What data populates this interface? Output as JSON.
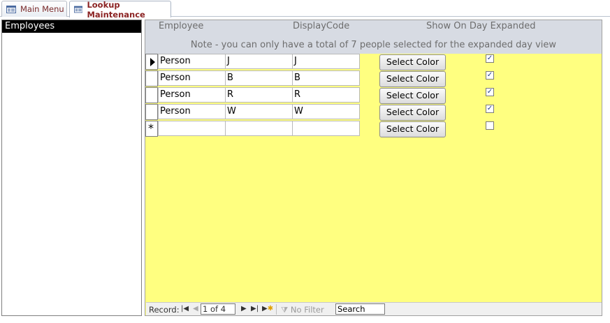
{
  "tabs": [
    {
      "label": "Main Menu",
      "active": false
    },
    {
      "label": "Lookup Maintenance",
      "active": true
    }
  ],
  "nav_list": {
    "items": [
      "Employees"
    ]
  },
  "form": {
    "headers": {
      "employee": "Employee",
      "display_code": "DisplayCode",
      "show_on_day": "Show On Day Expanded"
    },
    "note": "Note - you can only have a total of 7 people selected for the expanded day view",
    "button_label": "Select Color",
    "rows": [
      {
        "employee": "Person",
        "code": "J",
        "display": "J",
        "checked": true,
        "current": true
      },
      {
        "employee": "Person",
        "code": "B",
        "display": "B",
        "checked": true,
        "current": false
      },
      {
        "employee": "Person",
        "code": "R",
        "display": "R",
        "checked": true,
        "current": false
      },
      {
        "employee": "Person",
        "code": "W",
        "display": "W",
        "checked": true,
        "current": false
      }
    ],
    "new_row": {
      "checked": false
    }
  },
  "navbar": {
    "record_label": "Record:",
    "position": "1 of 4",
    "no_filter": "No Filter",
    "search": "Search"
  },
  "colors": {
    "form_bg": "#ffff80",
    "header_bg": "#d7dbe3",
    "tab_text": "#8b2323"
  }
}
